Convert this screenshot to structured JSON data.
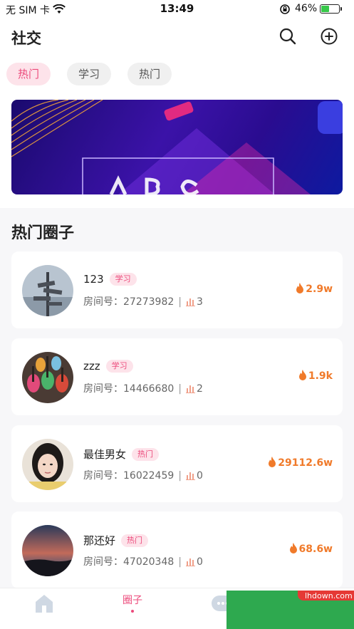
{
  "status_bar": {
    "carrier": "无 SIM 卡",
    "time": "13:49",
    "battery_pct": "46%",
    "battery_level": 0.46
  },
  "header": {
    "title": "社交",
    "search_icon": "search-icon",
    "add_icon": "plus-circle-icon"
  },
  "category_tabs": [
    {
      "label": "热门",
      "active": true
    },
    {
      "label": "学习",
      "active": false
    },
    {
      "label": "热门",
      "active": false
    }
  ],
  "section_title": "热门圈子",
  "room_id_prefix": "房间号：",
  "rooms": [
    {
      "name": "123",
      "tag": "学习",
      "room_id": "27273982",
      "count": "3",
      "heat": "2.9w"
    },
    {
      "name": "zzz",
      "tag": "学习",
      "room_id": "14466680",
      "count": "2",
      "heat": "1.9k"
    },
    {
      "name": "最佳男女",
      "tag": "热门",
      "room_id": "16022459",
      "count": "0",
      "heat": "29112.6w"
    },
    {
      "name": "那还好",
      "tag": "热门",
      "room_id": "47020348",
      "count": "0",
      "heat": "68.6w"
    }
  ],
  "tabbar": {
    "home_icon": "home-icon",
    "circle_label": "圈子",
    "message_icon": "message-icon"
  },
  "watermark": "lhdown.com",
  "colors": {
    "accent": "#ec4a7b",
    "heat": "#f07a2a",
    "tag_bg": "#fde3ea"
  }
}
